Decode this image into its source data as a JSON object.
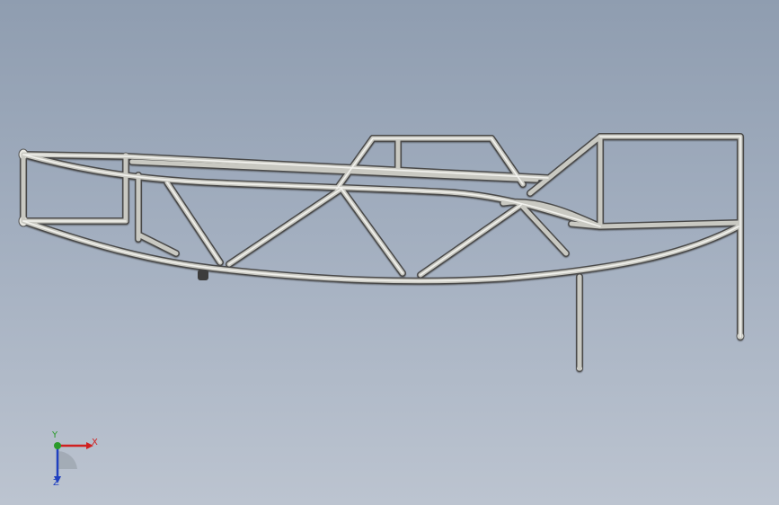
{
  "viewport": {
    "background_top": "#8f9db0",
    "background_bottom": "#bcc4d0"
  },
  "model": {
    "description_icon": "tube-frame-chassis",
    "tube_color": "#c9c9c2"
  },
  "triad": {
    "x_label": "X",
    "y_label": "Y",
    "z_label": "Z",
    "x_color": "#d02020",
    "y_color": "#2a9a2a",
    "z_color": "#2040c0"
  }
}
